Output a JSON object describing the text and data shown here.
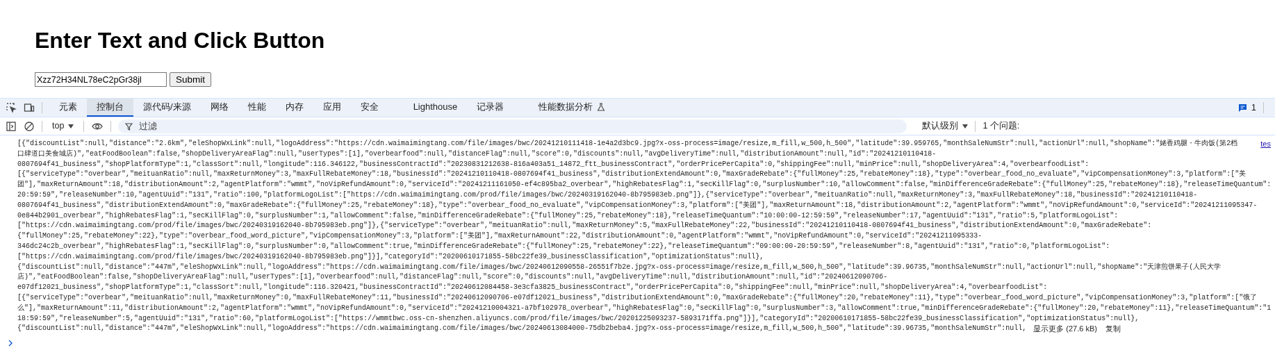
{
  "page": {
    "heading": "Enter Text and Click Button",
    "input": {
      "value": "Xzz72H34NL78eC2pGr38jl"
    },
    "button": "Submit"
  },
  "devtools": {
    "tabs": [
      {
        "label": "元素",
        "selected": false
      },
      {
        "label": "控制台",
        "selected": true
      },
      {
        "label": "源代码/来源",
        "selected": false
      },
      {
        "label": "网络",
        "selected": false
      },
      {
        "label": "性能",
        "selected": false
      },
      {
        "label": "内存",
        "selected": false
      },
      {
        "label": "应用",
        "selected": false
      },
      {
        "label": "安全",
        "selected": false
      },
      {
        "label": "Lighthouse",
        "selected": false
      },
      {
        "label": "记录器",
        "selected": false
      },
      {
        "label": "性能数据分析",
        "selected": false,
        "experimental": true
      }
    ],
    "messages_count": "1",
    "console_toolbar": {
      "context": "top",
      "filter": {
        "placeholder": "过滤"
      },
      "level": "默认级别",
      "issues": "1 个问题:"
    },
    "log": {
      "source_link": "tes",
      "lines": [
        "[{\"discountList\":null,\"distance\":\"2.6km\",\"eleShopWxLink\":null,\"logoAddress\":\"https://cdn.waimaimingtang.com/file/images/bwc/20241210111418-1e4a2d3bc9.jpg?x-oss-process=image/resize,m_fill,w_500,h_500\",\"latitude\":39.959765,\"monthSaleNumStr\":null,\"actionUrl\":null,\"shopName\":\"姥香鸡腿・牛肉饭(第2档",
        "口肆道口美食城店)\",\"eatFoodBoolean\":false,\"shopDeliveryAreaFlag\":null,\"userTypes\":[1],\"overbearfood\":null,\"distanceFlag\":null,\"score\":0,\"discounts\":null,\"avgDeliveryTime\":null,\"distributionAmount\":null,\"id\":\"20241210110418-",
        "0807694f41_business\",\"shopPlatformType\":1,\"classSort\":null,\"longitude\":116.346122,\"businessContractId\":\"20230831212638-816a403a51_14872_ftt_businessContract\",\"orderPricePerCapita\":0,\"shippingFee\":null,\"minPrice\":null,\"shopDeliveryArea\":4,\"overbearfoodList\":",
        "[{\"serviceType\":\"overbear\",\"meituanRatio\":null,\"maxReturnMoney\":3,\"maxFullRebateMoney\":18,\"businessId\":\"20241210110418-0807694f41_business\",\"distributionExtendAmount\":0,\"maxGradeRebate\":{\"fullMoney\":25,\"rebateMoney\":18},\"type\":\"overbear_food_no_evaluate\",\"vipCompensationMoney\":3,\"platform\":[\"美",
        "团\"],\"maxReturnAmount\":18,\"distributionAmount\":2,\"agentPlatform\":\"wmmt\",\"noVipRefundAmount\":0,\"serviceId\":\"20241211161050-ef4c895ba2_overbear\",\"highRebatesFlag\":1,\"secKillFlag\":0,\"surplusNumber\":10,\"allowComment\":false,\"minDifferenceGradeRebate\":{\"fullMoney\":25,\"rebateMoney\":18},\"releaseTimeQuantum\":",
        "20:59:59\",\"releaseNumber\":10,\"agentUuid\":\"131\",\"ratio\":100,\"platformLogoList\":[\"https://cdn.waimaimingtang.com/prod/file/images/bwc/20240319162040-8b795983eb.png\"]},{\"serviceType\":\"overbear\",\"meituanRatio\":null,\"maxReturnMoney\":3,\"maxFullRebateMoney\":18,\"businessId\":\"20241210110418-",
        "0807694f41_business\",\"distributionExtendAmount\":0,\"maxGradeRebate\":{\"fullMoney\":25,\"rebateMoney\":18},\"type\":\"overbear_food_no_evaluate\",\"vipCompensationMoney\":3,\"platform\":[\"美团\"],\"maxReturnAmount\":18,\"distributionAmount\":2,\"agentPlatform\":\"wmmt\",\"noVipRefundAmount\":0,\"serviceId\":\"20241211095347-",
        "0e844b2901_overbear\",\"highRebatesFlag\":1,\"secKillFlag\":0,\"surplusNumber\":1,\"allowComment\":false,\"minDifferenceGradeRebate\":{\"fullMoney\":25,\"rebateMoney\":18},\"releaseTimeQuantum\":\"10:00:00-12:59:59\",\"releaseNumber\":17,\"agentUuid\":\"131\",\"ratio\":5,\"platformLogoList\":",
        "[\"https://cdn.waimaimingtang.com/prod/file/images/bwc/20240319162040-8b795983eb.png\"]},{\"serviceType\":\"overbear\",\"meituanRatio\":null,\"maxReturnMoney\":5,\"maxFullRebateMoney\":22,\"businessId\":\"20241210110418-0807694f41_business\",\"distributionExtendAmount\":0,\"maxGradeRebate\":",
        "{\"fullMoney\":25,\"rebateMoney\":22},\"type\":\"overbear_food_word_picture\",\"vipCompensationMoney\":3,\"platform\":[\"美团\"],\"maxReturnAmount\":22,\"distributionAmount\":0,\"agentPlatform\":\"wmmt\",\"noVipRefundAmount\":0,\"serviceId\":\"20241211095333-",
        "346dc24c2b_overbear\",\"highRebatesFlag\":1,\"secKillFlag\":0,\"surplusNumber\":0,\"allowComment\":true,\"minDifferenceGradeRebate\":{\"fullMoney\":25,\"rebateMoney\":22},\"releaseTimeQuantum\":\"09:00:00-20:59:59\",\"releaseNumber\":8,\"agentUuid\":\"131\",\"ratio\":0,\"platformLogoList\":",
        "[\"https://cdn.waimaimingtang.com/prod/file/images/bwc/20240319162040-8b795983eb.png\"]}],\"categoryId\":\"20200610171855-58bc22fe39_businessClassification\",\"optimizationStatus\":null},",
        "{\"discountList\":null,\"distance\":\"447m\",\"eleShopWxLink\":null,\"logoAddress\":\"https://cdn.waimaimingtang.com/file/images/bwc/20240612090558-26551f7b2e.jpg?x-oss-process=image/resize,m_fill,w_500,h_500\",\"latitude\":39.96735,\"monthSaleNumStr\":null,\"actionUrl\":null,\"shopName\":\"天津煎饼果子(人民大学",
        "店)\",\"eatFoodBoolean\":false,\"shopDeliveryAreaFlag\":null,\"userTypes\":[1],\"overbearfood\":null,\"distanceFlag\":null,\"score\":0,\"discounts\":null,\"avgDeliveryTime\":null,\"distributionAmount\":null,\"id\":\"20240612090706-",
        "e07df12021_business\",\"shopPlatformType\":1,\"classSort\":null,\"longitude\":116.320421,\"businessContractId\":\"20240612084458-3e3cfa3825_businessContract\",\"orderPricePerCapita\":0,\"shippingFee\":null,\"minPrice\":null,\"shopDeliveryArea\":4,\"overbearfoodList\":",
        "[{\"serviceType\":\"overbear\",\"meituanRatio\":null,\"maxReturnMoney\":0,\"maxFullRebateMoney\":11,\"businessId\":\"20240612090706-e07df12021_business\",\"distributionExtendAmount\":0,\"maxGradeRebate\":{\"fullMoney\":20,\"rebateMoney\":11},\"type\":\"overbear_food_word_picture\",\"vipCompensationMoney\":3,\"platform\":[\"饿了",
        "么\"],\"maxReturnAmount\":11,\"distributionAmount\":2,\"agentPlatform\":\"wmmt\",\"noVipRefundAmount\":0,\"serviceId\":\"20241210004321-a7bf102978_overbear\",\"highRebatesFlag\":0,\"secKillFlag\":0,\"surplusNumber\":3,\"allowComment\":true,\"minDifferenceGradeRebate\":{\"fullMoney\":20,\"rebateMoney\":11},\"releaseTimeQuantum\":\"1",
        "18:59:59\",\"releaseNumber\":5,\"agentUuid\":\"131\",\"ratio\":60,\"platformLogoList\":[\"https://wmmtbwc.oss-cn-shenzhen.aliyuncs.com/prod/file/images/bwc/20201225093237-5893171ffa.png\"]}],\"categoryId\":\"20200610171855-58bc22fe39_businessClassification\",\"optimizationStatus\":null},",
        "{\"discountList\":null,\"distance\":\"447m\",\"eleShopWxLink\":null,\"logoAddress\":\"https://cdn.waimaimingtang.com/file/images/bwc/20240613084000-75db2beba4.jpg?x-oss-process=image/resize,m_fill,w_500,h_500\",\"latitude\":39.96735,\"monthSaleNumStr\":null,"
      ],
      "show_more": "显示更多 (27.6 kB)",
      "copy": "复制"
    }
  }
}
